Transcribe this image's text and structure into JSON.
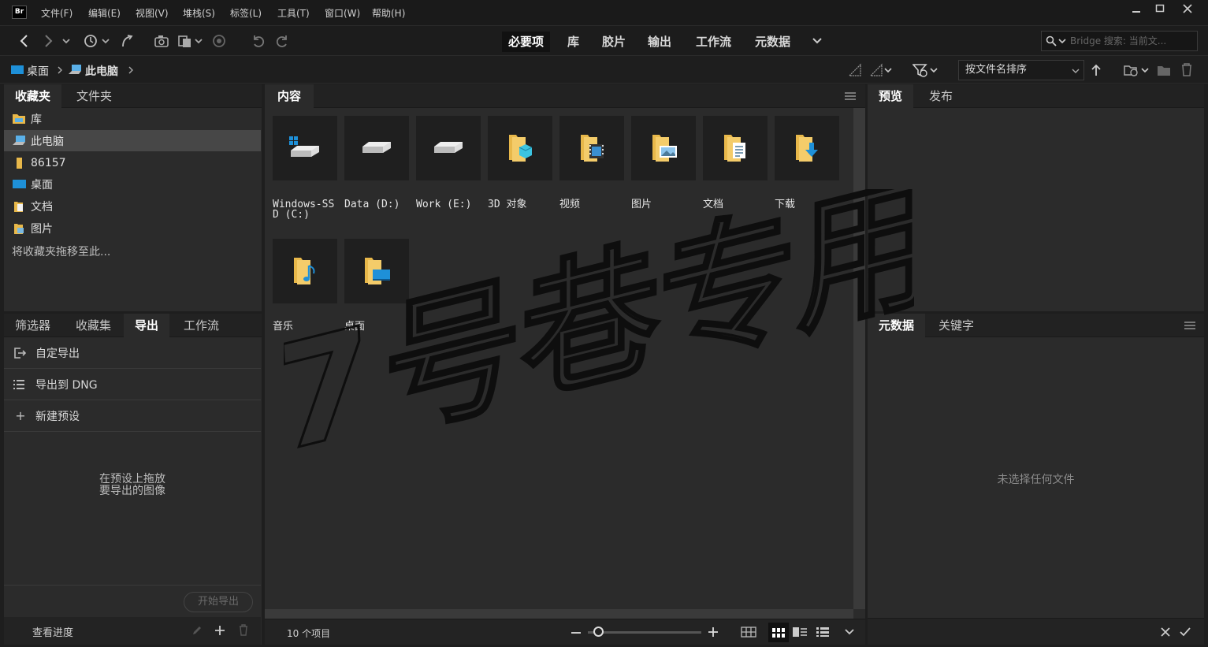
{
  "app": {
    "logo_text": "Br"
  },
  "menu": [
    "文件(F)",
    "编辑(E)",
    "视图(V)",
    "堆栈(S)",
    "标签(L)",
    "工具(T)",
    "窗口(W)",
    "帮助(H)"
  ],
  "workspaces": {
    "items": [
      "必要项",
      "库",
      "胶片",
      "输出",
      "工作流",
      "元数据"
    ],
    "active": "必要项"
  },
  "search": {
    "placeholder": "Bridge 搜索: 当前文..."
  },
  "path": {
    "items": [
      "桌面",
      "此电脑"
    ]
  },
  "sort": {
    "label": "按文件名排序"
  },
  "favorites_panel": {
    "tabs": [
      "收藏夹",
      "文件夹"
    ],
    "items": [
      {
        "label": "库",
        "icon": "library-folder-icon"
      },
      {
        "label": "此电脑",
        "icon": "computer-icon",
        "selected": true
      },
      {
        "label": "86157",
        "icon": "user-folder-icon"
      },
      {
        "label": "桌面",
        "icon": "desktop-icon"
      },
      {
        "label": "文档",
        "icon": "documents-folder-icon"
      },
      {
        "label": "图片",
        "icon": "pictures-folder-icon"
      }
    ],
    "hint": "将收藏夹拖移至此..."
  },
  "export_panel": {
    "tabs": [
      "筛选器",
      "收藏集",
      "导出",
      "工作流"
    ],
    "active_tab": "导出",
    "rows": [
      "自定导出",
      "导出到 DNG",
      "新建预设"
    ],
    "drop_hint_line1": "在预设上拖放",
    "drop_hint_line2": "要导出的图像",
    "start_button": "开始导出",
    "progress_link": "查看进度"
  },
  "content": {
    "tab": "内容",
    "items": [
      {
        "label": "Windows-SSD (C:)",
        "icon": "windows-drive-icon"
      },
      {
        "label": "Data (D:)",
        "icon": "drive-icon"
      },
      {
        "label": "Work (E:)",
        "icon": "drive-icon"
      },
      {
        "label": "3D 对象",
        "icon": "3d-objects-folder-icon"
      },
      {
        "label": "视频",
        "icon": "videos-folder-icon"
      },
      {
        "label": "图片",
        "icon": "pictures-folder-icon"
      },
      {
        "label": "文档",
        "icon": "documents-folder-icon"
      },
      {
        "label": "下载",
        "icon": "downloads-folder-icon"
      },
      {
        "label": "音乐",
        "icon": "music-folder-icon"
      },
      {
        "label": "桌面",
        "icon": "desktop-folder-icon"
      }
    ],
    "item_count": "10 个项目"
  },
  "preview_panel": {
    "tabs": [
      "预览",
      "发布"
    ]
  },
  "metadata_panel": {
    "tabs": [
      "元数据",
      "关键字"
    ],
    "empty_text": "未选择任何文件"
  },
  "watermark": "7号巷专用",
  "colors": {
    "folder": "#e8b84a",
    "accent_blue": "#1e90d8",
    "bg": "#1e1e1e",
    "panel": "#2b2b2b"
  }
}
